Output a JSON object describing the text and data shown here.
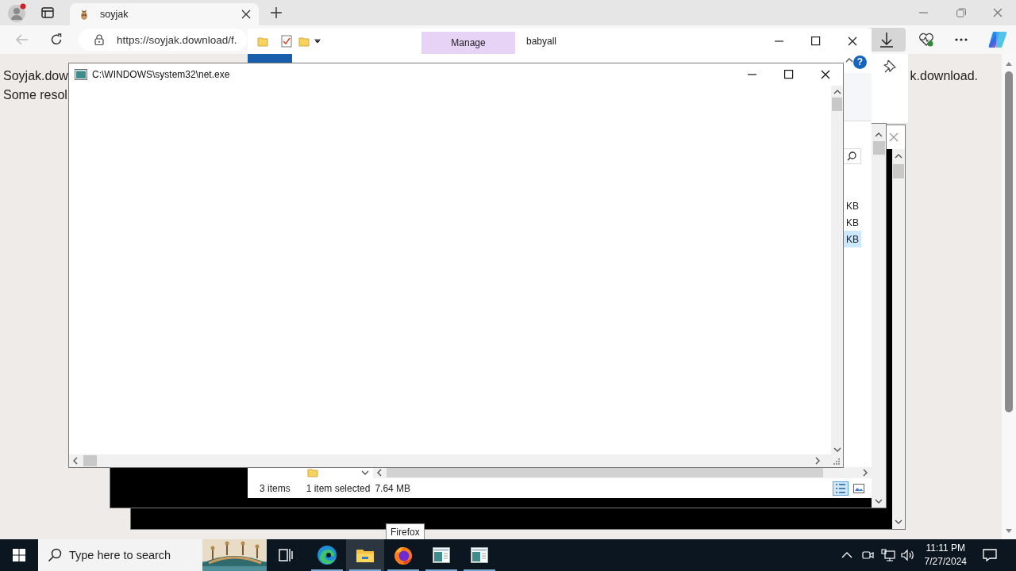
{
  "browser": {
    "tabs": [
      {
        "title": "soyjak",
        "selected": true
      }
    ],
    "address": "https://soyjak.download/f.",
    "page_lines": [
      "Soyjak.dow",
      "Some resol"
    ],
    "page_line_right": "k.download."
  },
  "explorer": {
    "title": "babyall",
    "context_tab": "Manage",
    "ribbon_tabs": [
      {
        "selected": true
      }
    ],
    "help_label": "?",
    "size_cells": [
      {
        "text": "KB",
        "selected": false
      },
      {
        "text": "KB",
        "selected": false
      },
      {
        "text": "KB",
        "selected": true
      }
    ],
    "status": {
      "count": "3 items",
      "selection": "1 item selected",
      "size": "7.64 MB"
    }
  },
  "console": {
    "title": "C:\\WINDOWS\\system32\\net.exe"
  },
  "tooltip": "Firefox",
  "taskbar": {
    "search_placeholder": "Type here to search",
    "apps": [
      {
        "kind": "edge",
        "selected": false
      },
      {
        "kind": "explorer",
        "selected": true
      },
      {
        "kind": "firefox",
        "selected": false
      },
      {
        "kind": "console",
        "selected": false
      },
      {
        "kind": "console",
        "selected": false
      }
    ],
    "time": "11:11 PM",
    "date": "7/27/2024"
  }
}
